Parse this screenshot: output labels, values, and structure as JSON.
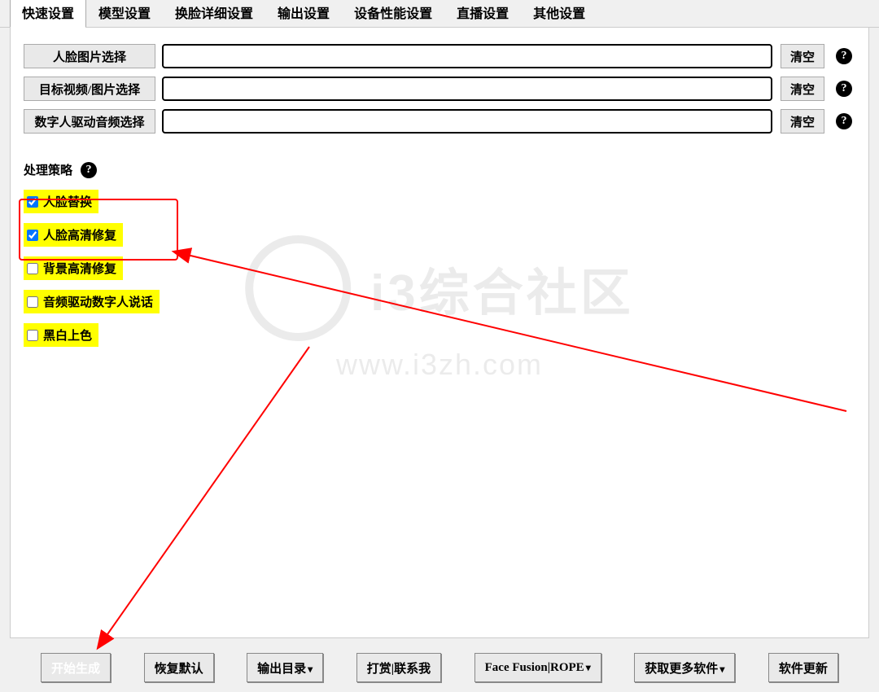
{
  "tabs": [
    "快速设置",
    "模型设置",
    "换脸详细设置",
    "输出设置",
    "设备性能设置",
    "直播设置",
    "其他设置"
  ],
  "active_tab": 0,
  "inputs": [
    {
      "label": "人脸图片选择",
      "value": "",
      "clear": "清空",
      "name": "face-image-select"
    },
    {
      "label": "目标视频/图片选择",
      "value": "",
      "clear": "清空",
      "name": "target-video-select"
    },
    {
      "label": "数字人驱动音频选择",
      "value": "",
      "clear": "清空",
      "name": "digital-audio-select"
    }
  ],
  "strategy_label": "处理策略",
  "options": [
    {
      "label": "人脸替换",
      "checked": true,
      "name": "opt-face-swap"
    },
    {
      "label": "人脸高清修复",
      "checked": true,
      "name": "opt-face-hd-restore"
    },
    {
      "label": "背景高清修复",
      "checked": false,
      "name": "opt-bg-hd-restore"
    },
    {
      "label": "音频驱动数字人说话",
      "checked": false,
      "name": "opt-audio-drive-talk"
    },
    {
      "label": "黑白上色",
      "checked": false,
      "name": "opt-colorize"
    }
  ],
  "footer": {
    "start": "开始生成",
    "restore": "恢复默认",
    "output_dir": "输出目录",
    "donate": "打赏|联系我",
    "face_fusion": "Face Fusion|ROPE",
    "more_software": "获取更多软件",
    "update": "软件更新"
  },
  "watermark": {
    "title": "i3综合社区",
    "url": "www.i3zh.com"
  }
}
